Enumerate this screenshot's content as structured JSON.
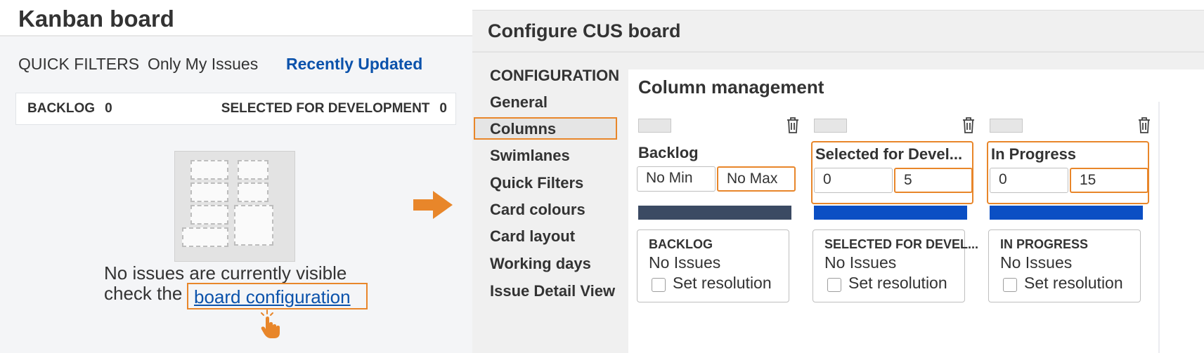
{
  "left": {
    "board_title": "Kanban board",
    "quick_filters": {
      "label": "QUICK FILTERS",
      "items": [
        "Only My Issues",
        "Recently Updated"
      ]
    },
    "columns_bar": {
      "left": {
        "name": "BACKLOG",
        "count": "0"
      },
      "right": {
        "name": "SELECTED FOR DEVELOPMENT",
        "count": "0"
      }
    },
    "empty_state": {
      "line1": "No issues are currently visible",
      "line2": "check the",
      "link": "board configuration"
    }
  },
  "right": {
    "title": "Configure CUS board",
    "nav": {
      "header": "CONFIGURATION",
      "items": [
        "General",
        "Columns",
        "Swimlanes",
        "Quick Filters",
        "Card colours",
        "Card layout",
        "Working days",
        "Issue Detail View"
      ],
      "selected": "Columns"
    },
    "section_title": "Column management",
    "columns": [
      {
        "name": "Backlog",
        "min": "No Min",
        "max": "No Max",
        "bar_color": "#3b4a63",
        "status": "BACKLOG",
        "issues": "No Issues",
        "resolution": "Set resolution"
      },
      {
        "name": "Selected for Devel...",
        "min": "0",
        "max": "5",
        "bar_color": "#0b4fc4",
        "status": "SELECTED FOR DEVEL...",
        "issues": "No Issues",
        "resolution": "Set resolution"
      },
      {
        "name": "In Progress",
        "min": "0",
        "max": "15",
        "bar_color": "#0b4fc4",
        "status": "IN PROGRESS",
        "issues": "No Issues",
        "resolution": "Set resolution"
      }
    ]
  },
  "colors": {
    "highlight": "#e8862a",
    "link": "#0b52ab"
  }
}
